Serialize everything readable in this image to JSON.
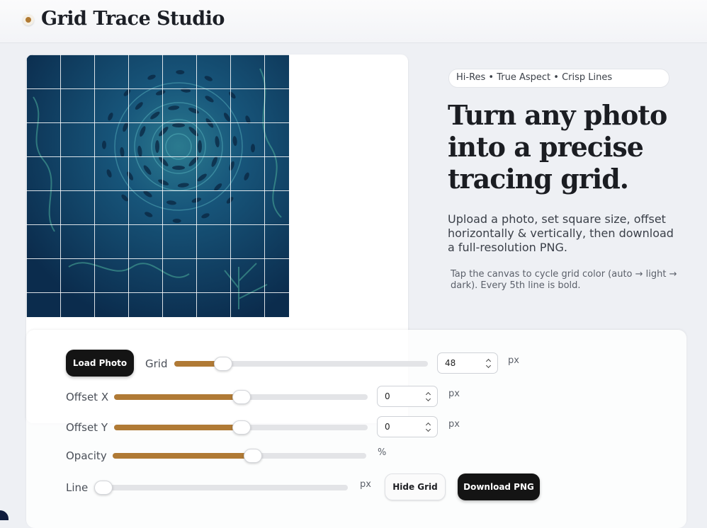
{
  "app": {
    "title": "Grid Trace Studio"
  },
  "hero": {
    "badge": "Hi-Res • True Aspect • Crisp Lines",
    "title": "Turn any photo into a precise tracing grid.",
    "description": "Upload a photo, set square size, offset horizontally & vertically, then download a full-resolution PNG.",
    "note": "Tap the canvas to cycle grid color (auto → light → dark). Every 5th line is bold."
  },
  "canvas": {
    "grid_color": "light",
    "bold_every": 5,
    "image": "underwater-fish-illustration"
  },
  "controls": {
    "load_photo_label": "Load Photo",
    "grid": {
      "label": "Grid",
      "value": "48",
      "unit": "px",
      "fraction": 0.19
    },
    "offset_x": {
      "label": "Offset X",
      "value": "0",
      "unit": "px",
      "fraction": 0.5
    },
    "offset_y": {
      "label": "Offset Y",
      "value": "0",
      "unit": "px",
      "fraction": 0.5
    },
    "opacity": {
      "label": "Opacity",
      "unit": "%",
      "fraction": 0.55
    },
    "line": {
      "label": "Line",
      "unit": "px",
      "fraction": 0.0
    },
    "hide_grid_label": "Hide Grid",
    "download_label": "Download PNG"
  },
  "colors": {
    "accent": "#b07a35",
    "button_dark": "#141414",
    "photo_bg": "#0e3a5a"
  }
}
